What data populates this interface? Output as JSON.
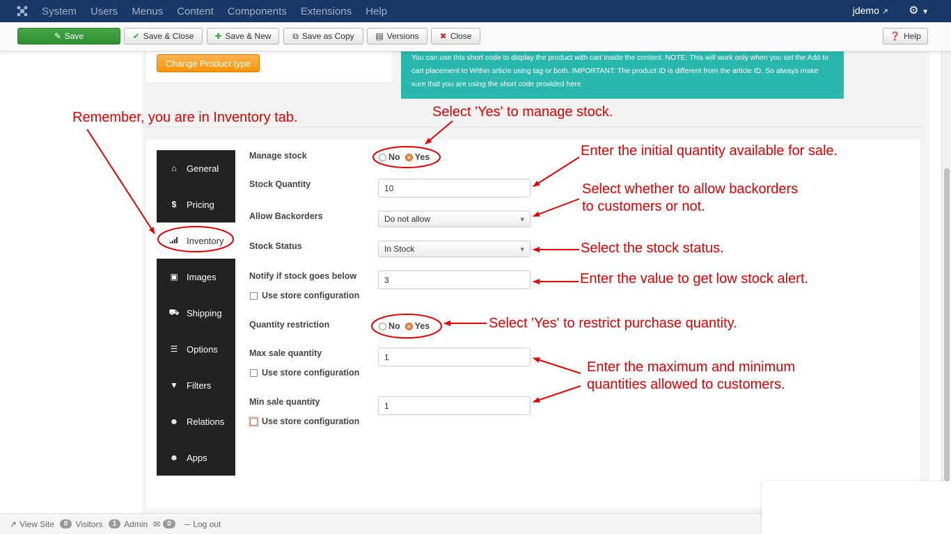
{
  "topnav": {
    "menu": [
      "System",
      "Users",
      "Menus",
      "Content",
      "Components",
      "Extensions",
      "Help"
    ],
    "user": "jdemo",
    "user_icon": "external-link-icon",
    "settings_icon": "gear-icon"
  },
  "toolbar": {
    "save": "Save",
    "save_close": "Save & Close",
    "save_new": "Save & New",
    "save_copy": "Save as Copy",
    "versions": "Versions",
    "close": "Close",
    "help": "Help"
  },
  "product": {
    "change_type": "Change Product type",
    "note": "You can use this short code to display the product with cart inside the content. NOTE: This will work only when you set the Add to cart placement to Within article using tag or both. IMPORTANT: The product ID is different from the article ID. So always make sure that you are using the short code provided here"
  },
  "tabs": [
    {
      "label": "General",
      "icon": "home-icon"
    },
    {
      "label": "Pricing",
      "icon": "dollar-icon"
    },
    {
      "label": "Inventory",
      "icon": "signal-icon"
    },
    {
      "label": "Images",
      "icon": "image-icon"
    },
    {
      "label": "Shipping",
      "icon": "truck-icon"
    },
    {
      "label": "Options",
      "icon": "sitemap-icon"
    },
    {
      "label": "Filters",
      "icon": "filter-icon"
    },
    {
      "label": "Relations",
      "icon": "users-icon"
    },
    {
      "label": "Apps",
      "icon": "users-icon"
    }
  ],
  "form": {
    "manage_stock": {
      "label": "Manage stock",
      "no": "No",
      "yes": "Yes",
      "selected": "Yes"
    },
    "stock_quantity": {
      "label": "Stock Quantity",
      "value": "10"
    },
    "allow_backorders": {
      "label": "Allow Backorders",
      "value": "Do not allow"
    },
    "stock_status": {
      "label": "Stock Status",
      "value": "In Stock"
    },
    "notify_below": {
      "label": "Notify if stock goes below",
      "value": "3",
      "checkbox": "Use store configuration"
    },
    "quantity_restriction": {
      "label": "Quantity restriction",
      "no": "No",
      "yes": "Yes",
      "selected": "Yes"
    },
    "max_sale": {
      "label": "Max sale quantity",
      "value": "1",
      "checkbox": "Use store configuration"
    },
    "min_sale": {
      "label": "Min sale quantity",
      "value": "1",
      "checkbox": "Use store configuration"
    }
  },
  "annotations": {
    "inventory_tab": "Remember, you are in Inventory tab.",
    "manage_stock": "Select 'Yes' to manage stock.",
    "initial_qty": "Enter the initial quantity available for sale.",
    "backorders_1": "Select whether to allow backorders",
    "backorders_2": "to customers or not.",
    "stock_status": "Select the stock status.",
    "low_stock": "Enter the value to get low stock alert.",
    "restrict": "Select 'Yes' to restrict purchase quantity.",
    "maxmin_1": "Enter the maximum and minimum",
    "maxmin_2": "quantities allowed to customers."
  },
  "statusbar": {
    "view_site": "View Site",
    "visitors_count": "0",
    "visitors": "Visitors",
    "admin_count": "1",
    "admin": "Admin",
    "messages_count": "0",
    "logout": "Log out"
  },
  "colors": {
    "annotation": "#e00000",
    "save": "#46a546",
    "change_type": "#f89406",
    "note": "#2ab7ac",
    "navbar": "#1a3867"
  }
}
